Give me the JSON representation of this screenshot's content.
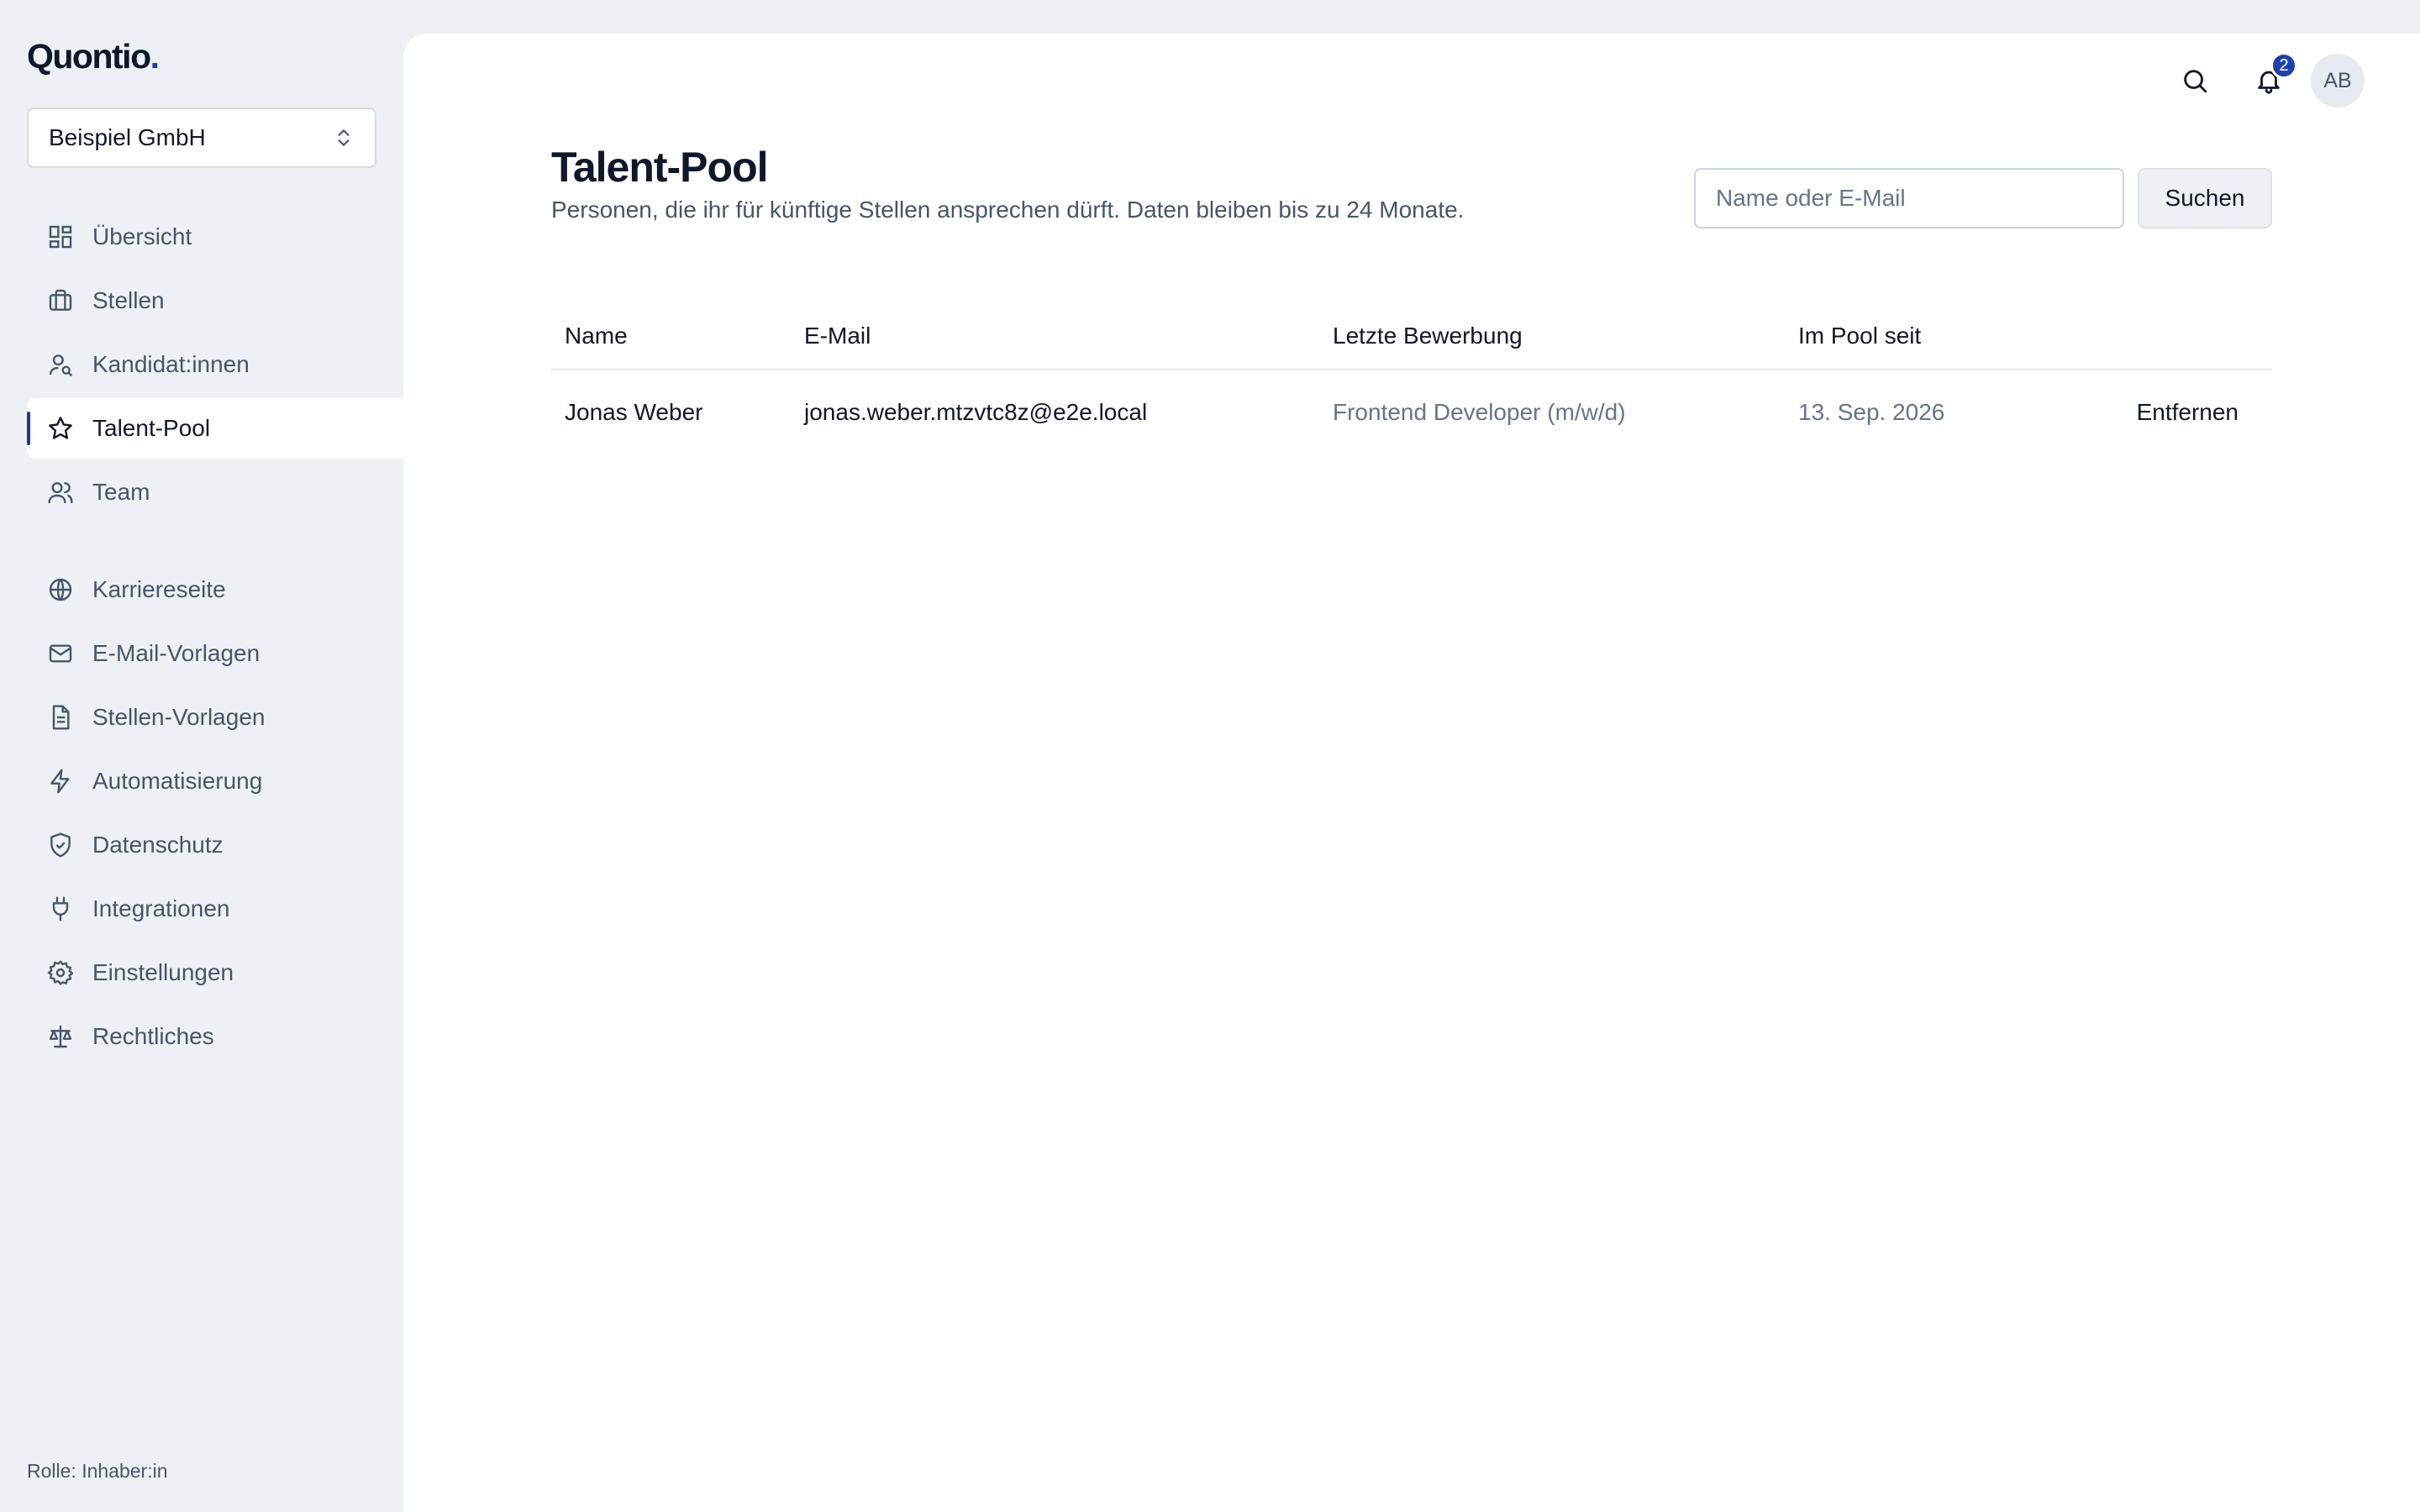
{
  "brand": {
    "name": "Quontio",
    "dot": "."
  },
  "org_select": {
    "value": "Beispiel GmbH"
  },
  "nav": {
    "primary": [
      {
        "label": "Übersicht",
        "icon": "dashboard-icon"
      },
      {
        "label": "Stellen",
        "icon": "briefcase-icon"
      },
      {
        "label": "Kandidat:innen",
        "icon": "user-search-icon"
      },
      {
        "label": "Talent-Pool",
        "icon": "star-icon",
        "active": true
      },
      {
        "label": "Team",
        "icon": "users-icon"
      }
    ],
    "secondary": [
      {
        "label": "Karriereseite",
        "icon": "globe-icon"
      },
      {
        "label": "E-Mail-Vorlagen",
        "icon": "mail-icon"
      },
      {
        "label": "Stellen-Vorlagen",
        "icon": "document-icon"
      },
      {
        "label": "Automatisierung",
        "icon": "lightning-icon"
      },
      {
        "label": "Datenschutz",
        "icon": "shield-check-icon"
      },
      {
        "label": "Integrationen",
        "icon": "plug-icon"
      },
      {
        "label": "Einstellungen",
        "icon": "gear-icon"
      },
      {
        "label": "Rechtliches",
        "icon": "scale-icon"
      }
    ]
  },
  "footer": {
    "role": "Rolle: Inhaber:in"
  },
  "topbar": {
    "notification_count": "2",
    "avatar_initials": "AB"
  },
  "page": {
    "title": "Talent-Pool",
    "subtitle": "Personen, die ihr für künftige Stellen ansprechen dürft. Daten bleiben bis zu 24 Monate.",
    "search_placeholder": "Name oder E-Mail",
    "search_button": "Suchen"
  },
  "table": {
    "columns": [
      "Name",
      "E-Mail",
      "Letzte Bewerbung",
      "Im Pool seit"
    ],
    "rows": [
      {
        "name": "Jonas Weber",
        "email": "jonas.weber.mtzvtc8z@e2e.local",
        "last_application": "Frontend Developer (m/w/d)",
        "pool_since": "13. Sep. 2026",
        "action": "Entfernen"
      }
    ]
  },
  "colors": {
    "accent": "#1e40af",
    "sidebar_bg": "#edf1f5",
    "text_muted": "#475569"
  }
}
